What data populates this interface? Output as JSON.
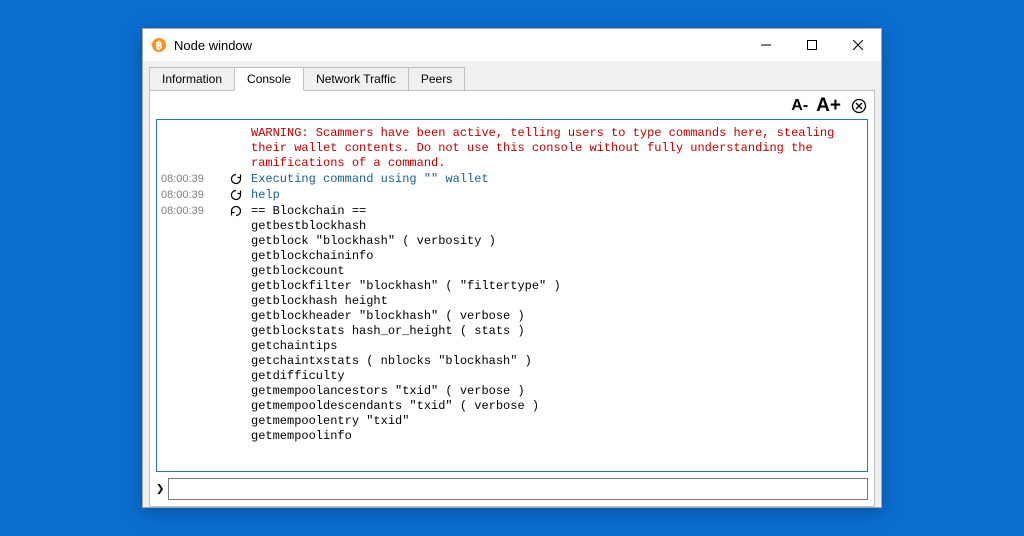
{
  "window": {
    "title": "Node window"
  },
  "tabs": [
    {
      "label": "Information"
    },
    {
      "label": "Console"
    },
    {
      "label": "Network Traffic"
    },
    {
      "label": "Peers"
    }
  ],
  "active_tab": 1,
  "fontbar": {
    "decrease": "A-",
    "increase": "A+"
  },
  "console": {
    "warning": "WARNING: Scammers have been active, telling users to type commands here, stealing\ntheir wallet contents. Do not use this console without fully understanding the\nramifications of a command.",
    "entries": [
      {
        "ts": "08:00:39",
        "dir": "exec",
        "text": "Executing command using \"\" wallet"
      },
      {
        "ts": "08:00:39",
        "dir": "in",
        "text": "help"
      }
    ],
    "last_ts": "08:00:39",
    "help_output": "== Blockchain ==\ngetbestblockhash\ngetblock \"blockhash\" ( verbosity )\ngetblockchaininfo\ngetblockcount\ngetblockfilter \"blockhash\" ( \"filtertype\" )\ngetblockhash height\ngetblockheader \"blockhash\" ( verbose )\ngetblockstats hash_or_height ( stats )\ngetchaintips\ngetchaintxstats ( nblocks \"blockhash\" )\ngetdifficulty\ngetmempoolancestors \"txid\" ( verbose )\ngetmempooldescendants \"txid\" ( verbose )\ngetmempoolentry \"txid\"\ngetmempoolinfo"
  },
  "input": {
    "prompt": "❯",
    "value": ""
  }
}
